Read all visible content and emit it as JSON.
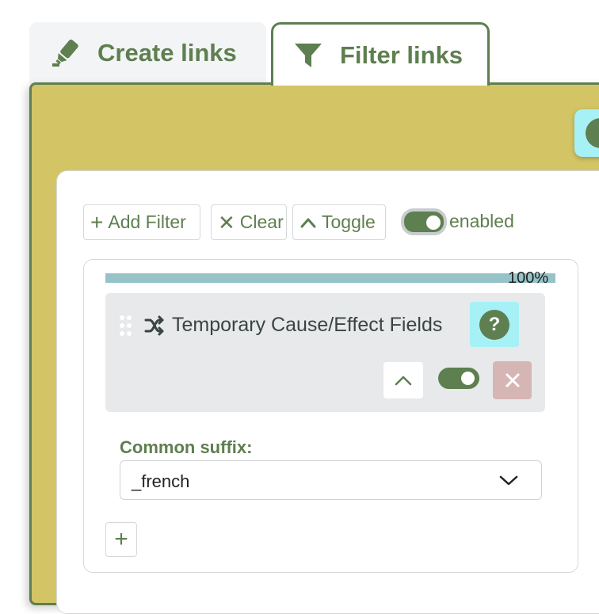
{
  "tabs": [
    {
      "label": "Create links",
      "icon": "highlighter-icon",
      "active": false
    },
    {
      "label": "Filter links",
      "icon": "funnel-icon",
      "active": true
    }
  ],
  "toolbar": {
    "add_filter_label": "Add Filter",
    "clear_label": "Clear",
    "toggle_label": "Toggle",
    "enabled_label": "enabled",
    "enabled": true
  },
  "filter": {
    "progress_text": "100%",
    "progress": 1.0,
    "title": "Temporary Cause/Effect Fields",
    "enabled": true,
    "help_symbol": "?",
    "field_label": "Common suffix:",
    "field_value": "_french",
    "add_symbol": "+"
  },
  "colors": {
    "accent": "#5e7f4f",
    "panel_background": "#d3c565",
    "help_button": "#a6f1f6",
    "remove_button": "#d6b6b5",
    "progress_bar": "#96c3c8",
    "card_background": "#e8e9ea"
  }
}
